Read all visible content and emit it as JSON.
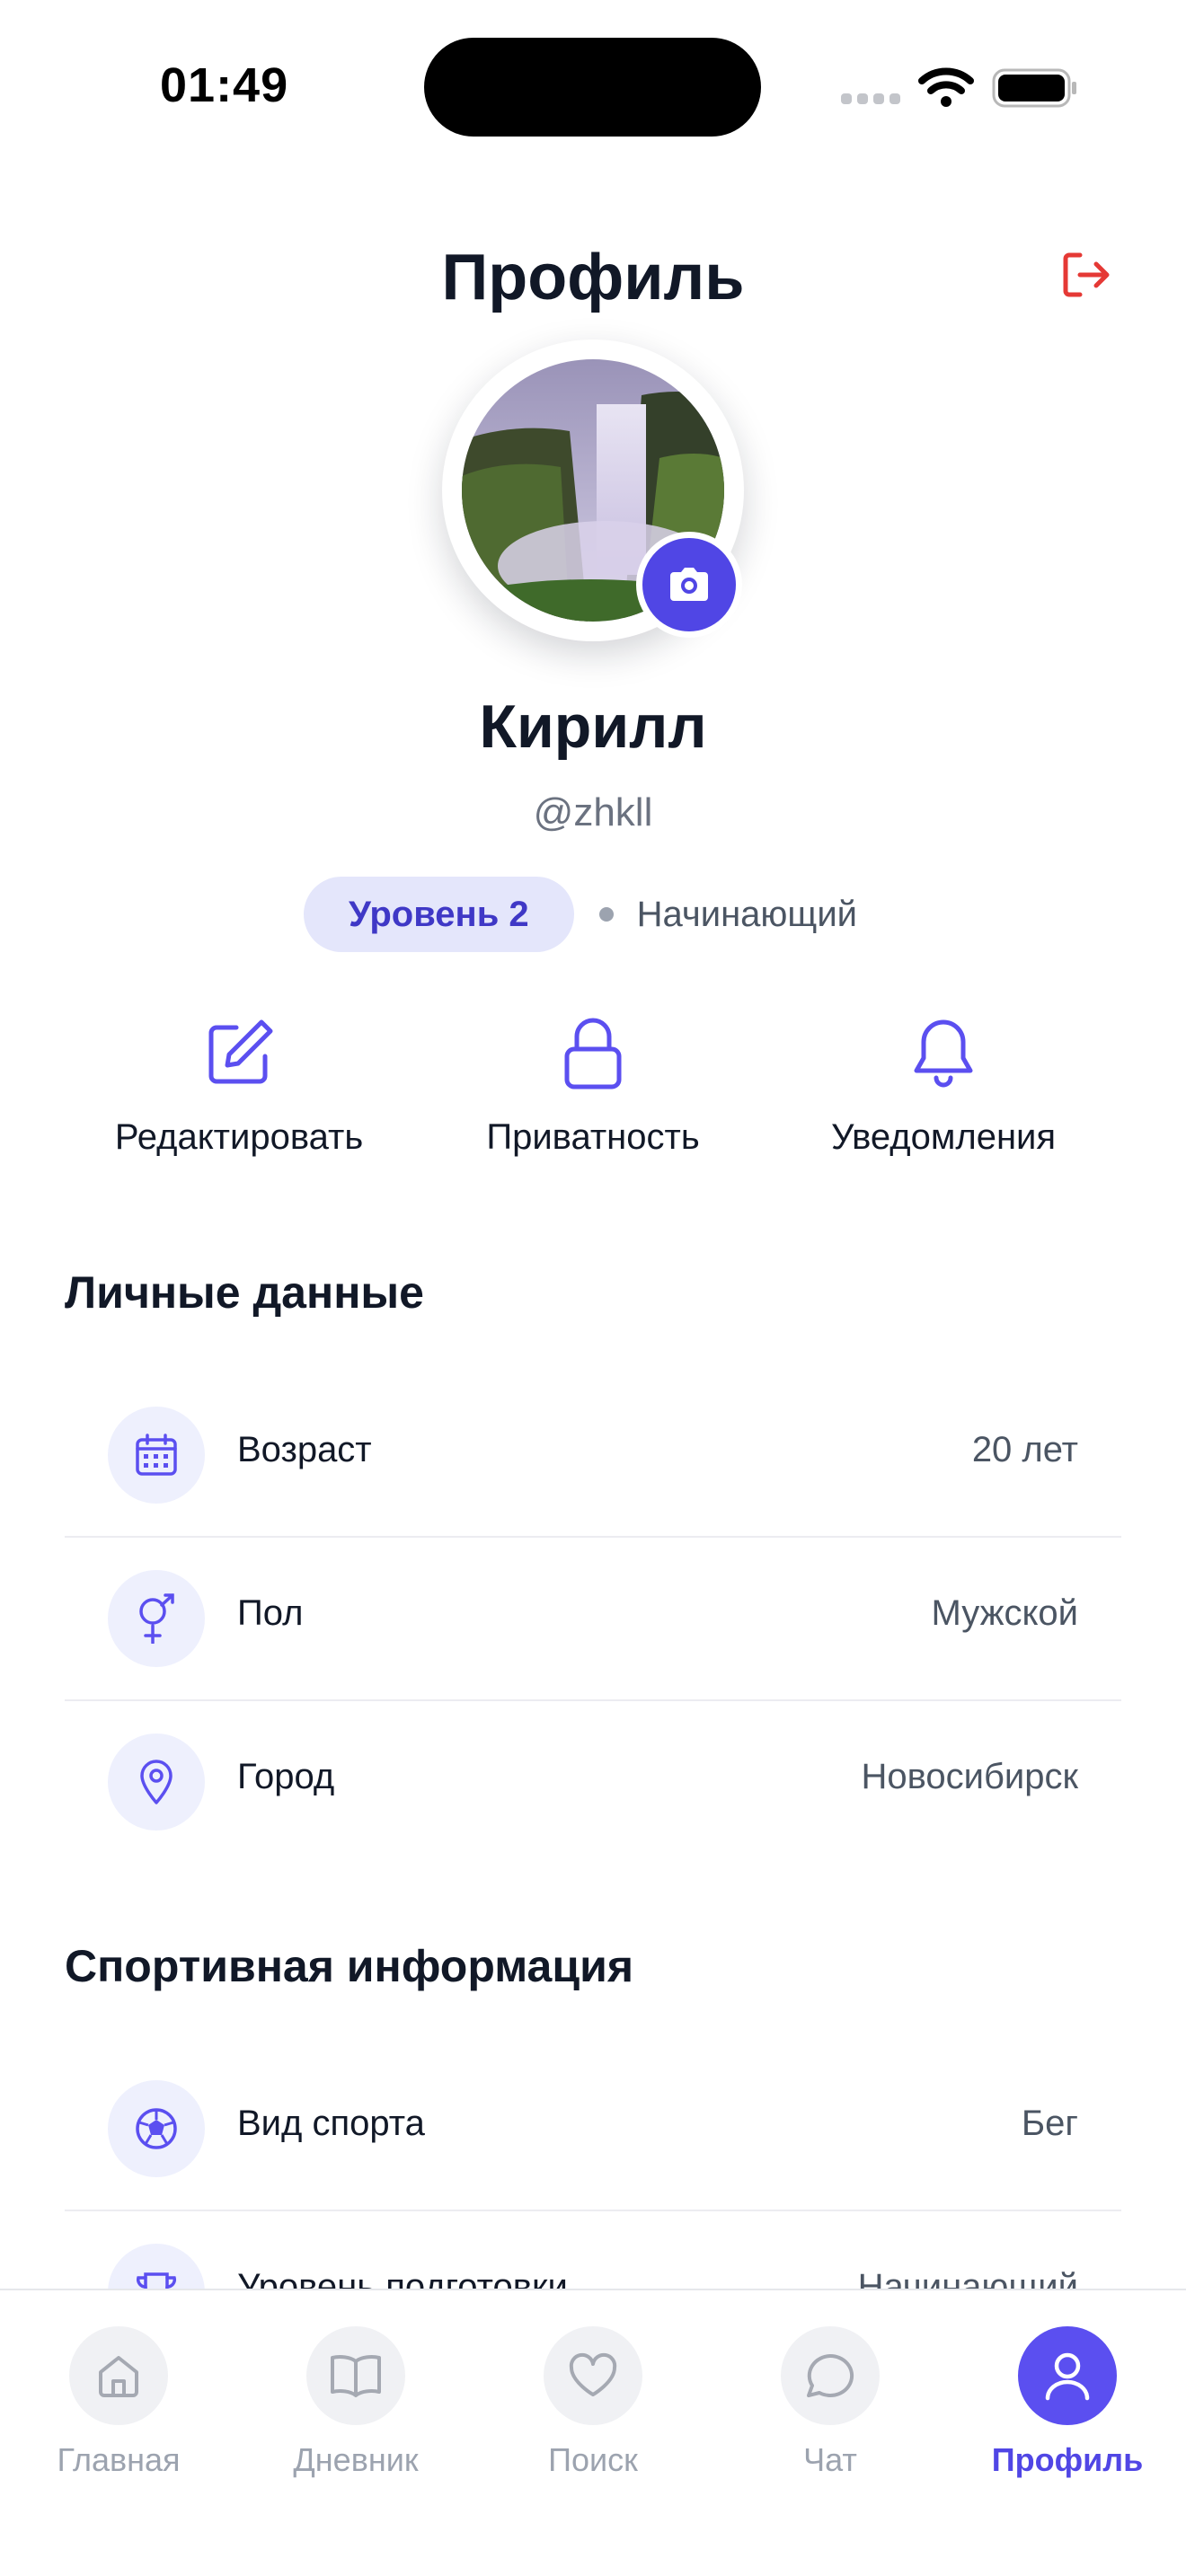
{
  "status_bar": {
    "time": "01:49"
  },
  "header": {
    "title": "Профиль"
  },
  "profile": {
    "name": "Кирилл",
    "handle": "@zhkll",
    "level": "Уровень 2",
    "level_status": "Начинающий"
  },
  "actions": [
    {
      "label": "Редактировать",
      "icon": "edit-icon"
    },
    {
      "label": "Приватность",
      "icon": "lock-icon"
    },
    {
      "label": "Уведомления",
      "icon": "bell-icon"
    }
  ],
  "personal": {
    "title": "Личные данные",
    "rows": [
      {
        "label": "Возраст",
        "value": "20 лет",
        "icon": "calendar-icon"
      },
      {
        "label": "Пол",
        "value": "Мужской",
        "icon": "gender-icon"
      },
      {
        "label": "Город",
        "value": "Новосибирск",
        "icon": "location-pin-icon"
      }
    ]
  },
  "sport": {
    "title": "Спортивная информация",
    "rows": [
      {
        "label": "Вид спорта",
        "value": "Бег",
        "icon": "ball-icon"
      },
      {
        "label": "Уровень подготовки",
        "value": "Начинающий",
        "icon": "trophy-icon"
      }
    ]
  },
  "tabs": [
    {
      "label": "Главная",
      "icon": "home-icon",
      "active": false
    },
    {
      "label": "Дневник",
      "icon": "book-icon",
      "active": false
    },
    {
      "label": "Поиск",
      "icon": "heart-icon",
      "active": false
    },
    {
      "label": "Чат",
      "icon": "chat-icon",
      "active": false
    },
    {
      "label": "Профиль",
      "icon": "user-icon",
      "active": true
    }
  ],
  "colors": {
    "accent": "#5046e5",
    "logout": "#e53935",
    "level_pill_bg": "#e4e6fb",
    "icon_circle_bg": "#eef0fd"
  }
}
